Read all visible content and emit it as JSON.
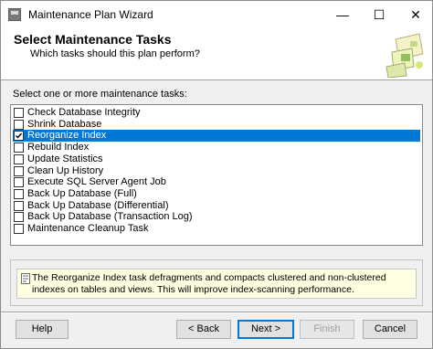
{
  "window": {
    "title": "Maintenance Plan Wizard",
    "minimize_glyph": "—",
    "maximize_glyph": "☐",
    "close_glyph": "✕"
  },
  "header": {
    "title": "Select Maintenance Tasks",
    "subtitle": "Which tasks should this plan perform?"
  },
  "tasks_label": "Select one or more maintenance tasks:",
  "tasks": [
    {
      "label": "Check Database Integrity",
      "checked": false,
      "selected": false
    },
    {
      "label": "Shrink Database",
      "checked": false,
      "selected": false
    },
    {
      "label": "Reorganize Index",
      "checked": true,
      "selected": true
    },
    {
      "label": "Rebuild Index",
      "checked": false,
      "selected": false
    },
    {
      "label": "Update Statistics",
      "checked": false,
      "selected": false
    },
    {
      "label": "Clean Up History",
      "checked": false,
      "selected": false
    },
    {
      "label": "Execute SQL Server Agent Job",
      "checked": false,
      "selected": false
    },
    {
      "label": "Back Up Database (Full)",
      "checked": false,
      "selected": false
    },
    {
      "label": "Back Up Database (Differential)",
      "checked": false,
      "selected": false
    },
    {
      "label": "Back Up Database (Transaction Log)",
      "checked": false,
      "selected": false
    },
    {
      "label": "Maintenance Cleanup Task",
      "checked": false,
      "selected": false
    }
  ],
  "description": "The Reorganize Index task defragments and compacts clustered and non-clustered indexes on tables and views. This will improve index-scanning performance.",
  "buttons": {
    "help": "Help",
    "back": "< Back",
    "next": "Next >",
    "finish": "Finish",
    "cancel": "Cancel"
  },
  "colors": {
    "selection": "#0078d7",
    "description_background": "#ffffe1",
    "dialog_background": "#f0f0f0"
  }
}
